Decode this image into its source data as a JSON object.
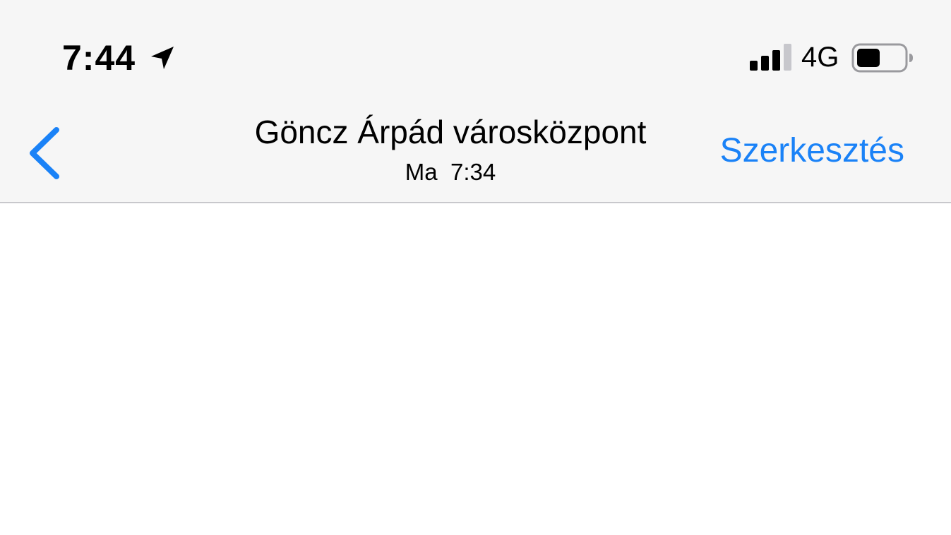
{
  "status_bar": {
    "time": "7:44",
    "location_icon": "location-arrow-icon",
    "signal_icon": "cellular-signal-icon",
    "signal_bars_filled": 3,
    "signal_bars_total": 4,
    "network": "4G",
    "battery_icon": "battery-icon",
    "battery_level": 0.5
  },
  "nav": {
    "back_icon": "chevron-left-icon",
    "title": "Göncz Árpád városközpont",
    "subtitle": "Ma  7:34",
    "edit_label": "Szerkesztés"
  },
  "colors": {
    "accent": "#1a82f7",
    "bar_background": "#f6f6f6",
    "separator": "#c8c8cc"
  }
}
